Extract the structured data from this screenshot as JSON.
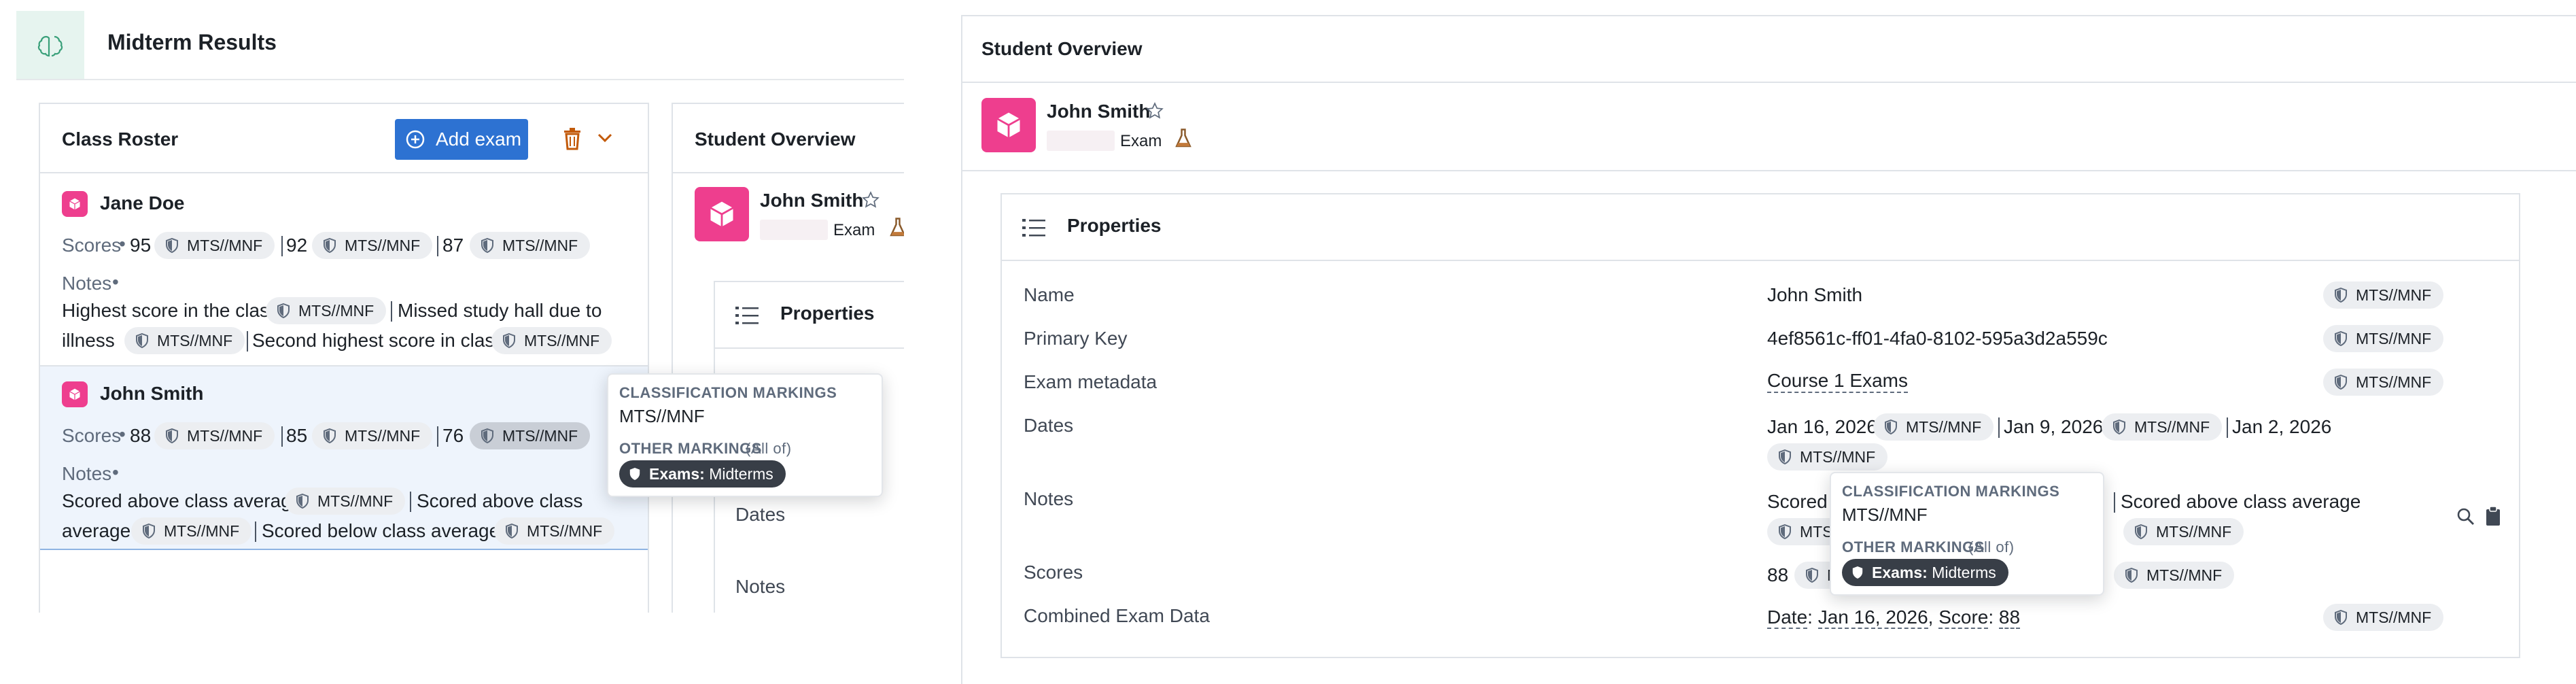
{
  "app": {
    "title": "Midterm Results"
  },
  "tag_label": "MTS//MNF",
  "roster": {
    "title": "Class Roster",
    "add_exam": "Add exam",
    "scores_label": "Scores",
    "notes_label": "Notes",
    "items": [
      {
        "name": "Jane Doe",
        "scores": [
          "95",
          "92",
          "87"
        ],
        "notes": [
          "Highest score in the class",
          "Missed study hall due to",
          "illness",
          "Second highest score in class"
        ]
      },
      {
        "name": "John Smith",
        "scores": [
          "88",
          "85",
          "76"
        ],
        "notes": [
          "Scored above class average",
          "Scored above class",
          "average",
          "Scored below class average"
        ]
      }
    ]
  },
  "tooltip": {
    "classification_heading": "CLASSIFICATION MARKINGS",
    "classification_value": "MTS//MNF",
    "other_heading": "OTHER MARKINGS",
    "other_qualifier": "(All of)",
    "pill_key": "Exams:",
    "pill_value": "Midterms"
  },
  "overview": {
    "title": "Student Overview",
    "name": "John Smith",
    "type": "Exam",
    "properties_title": "Properties",
    "left_labels": [
      "Dates",
      "Notes"
    ],
    "rows": [
      {
        "label": "Name",
        "value": "John Smith"
      },
      {
        "label": "Primary Key",
        "value": "4ef8561c-ff01-4fa0-8102-595a3d2a559c"
      },
      {
        "label": "Exam metadata",
        "value": "Course 1 Exams"
      },
      {
        "label": "Dates",
        "values": [
          "Jan 16, 2026",
          "Jan 9, 2026",
          "Jan 2, 2026"
        ]
      },
      {
        "label": "Notes",
        "values": [
          "Scored a",
          "Scored above class average",
          "e"
        ]
      },
      {
        "label": "Scores",
        "value": "88"
      },
      {
        "label": "Combined Exam Data",
        "date_key": "Date",
        "date_value": "Jan 16, 2026",
        "score_key": "Score",
        "score_value": "88"
      }
    ]
  }
}
